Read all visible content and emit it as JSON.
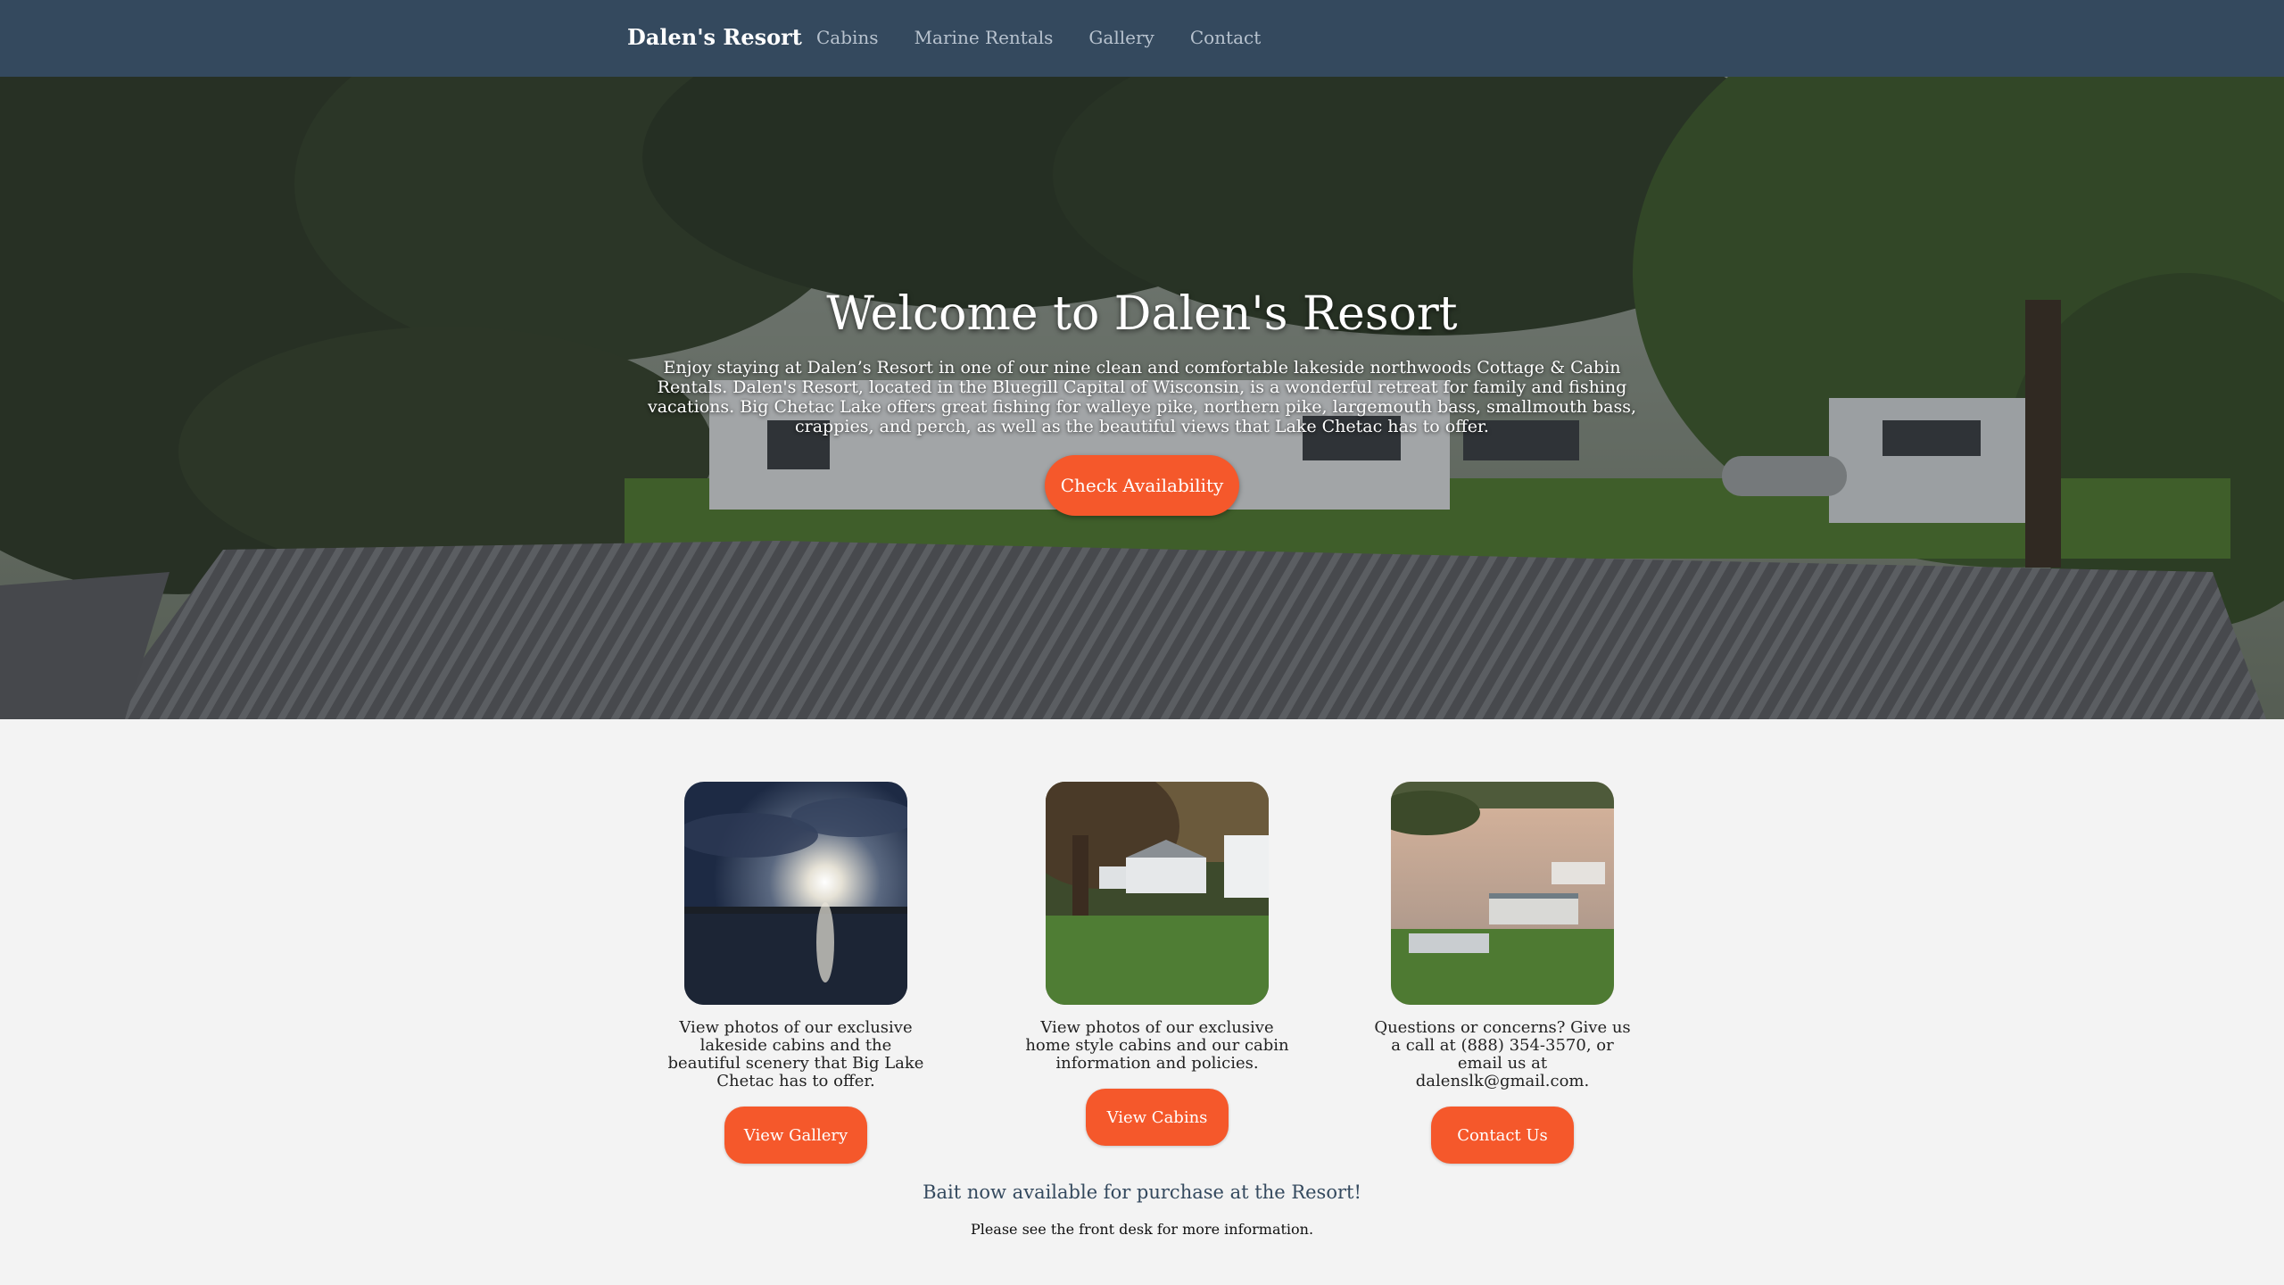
{
  "nav": {
    "brand": "Dalen's Resort",
    "links": [
      "Cabins",
      "Marine Rentals",
      "Gallery",
      "Contact"
    ]
  },
  "hero": {
    "title": "Welcome to Dalen's Resort",
    "text": "Enjoy staying at Dalen’s Resort in one of our nine clean and comfortable lakeside northwoods Cottage & Cabin Rentals. Dalen's Resort, located in the Bluegill Capital of Wisconsin, is a wonderful retreat for family and fishing vacations. Big Chetac Lake offers great fishing for walleye pike, northern pike, largemouth bass, smallmouth bass, crappies, and perch, as well as the beautiful views that Lake Chetac has to offer.",
    "button": "Check Availability"
  },
  "features": [
    {
      "text": "View photos of our exclusive lakeside cabins and the beautiful scenery that Big Lake Chetac has to offer.",
      "button": "View Gallery"
    },
    {
      "text": "View photos of our exclusive home style cabins and our cabin information and policies.",
      "button": "View Cabins"
    },
    {
      "text": "Questions or concerns? Give us a call at (888) 354-3570, or email us at dalenslk@gmail.com.",
      "button": "Contact Us"
    }
  ],
  "notice": {
    "title": "Bait now available for purchase at the Resort!",
    "text": "Please see the front desk for more information."
  },
  "colors": {
    "navbar": "#34495e",
    "accent": "#f5582b",
    "page_background": "#f3f3f3"
  }
}
